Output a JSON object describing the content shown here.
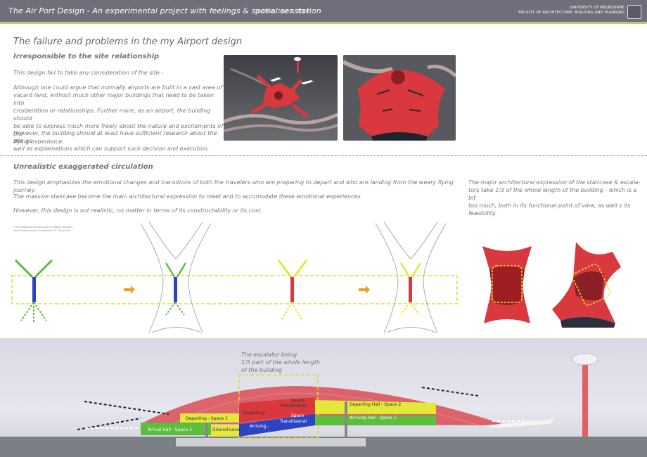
{
  "header": {
    "title": "The Air Port Design - An experimental project with feelings & spatial senstation",
    "subtitle": "3rd Year, Sem 1, 2008",
    "university": "UNIVERSITY OF MELBOURNE",
    "faculty": "FACULTY OF ARCHITECTURE, BUILDING AND PLANNING"
  },
  "section1": {
    "title": "The failure and problems in the my Airport design",
    "subtitle": "Irresponsible to the site relationship",
    "p1": "This design fail to take any consideration of the site -",
    "p2_lines": [
      "Although one could argue that normally airports are built in a vast area of",
      "vacant land, without much other major buildings that need to be taken into",
      "cnsideration or relationships. Further more, as an airport, the building should",
      "be able to express much more freely about the nature and excitements of the",
      "flying experience."
    ],
    "p3_lines": [
      "However, the building should at least have sufficient research about the site as",
      "well as explainations which can support such decision and execution."
    ]
  },
  "section2": {
    "subtitle": "Unrealistic exaggerated circulation",
    "p1": "This design emphasizes the emotional changes and transitions of both the travelers who are preparing to depart and who are landing from the weary flying journey.",
    "p2": "The massive staircase become the main architectural expression to meet and to accomodate these emotional experiences.",
    "p3": "However, this design is not realistic, no matter in terms of its constructability or its cost.",
    "side_note_lines": [
      "The major architectural expression of the staircase & escala-",
      "tors take 1/3 of the whole length of the building - which is a bit",
      "too much, both in its functional point of view, as well s its",
      "feasibility."
    ],
    "diagram_note_lines": [
      "~The diagrams showing flow of depart normally",
      "work flow/normally for departure & The arrival"
    ]
  },
  "section3": {
    "escalator_lines": [
      "The escalator being",
      "1/3 part of the whole length",
      "of the building"
    ],
    "labels": {
      "departing_space1": "Departing - Space 1",
      "departing_hall2": "Departing Hall - Space 2",
      "arrival_hall2": "Arrival Hall - Space 2",
      "ground_level": "Ground Level",
      "arriving": "Arriving -",
      "arriving_hall1": "Arriving Hall - Space 1",
      "departing": "Departing",
      "space_upper": "Space",
      "transitional_upper": "Transitiaonal",
      "space_lower": "Space",
      "transitional_lower": "Transitiaonal"
    }
  },
  "colors": {
    "header_bg": "#6e6f7a",
    "header_accent": "#c9c46a",
    "roof_red": "#d8383e",
    "yellow": "#e3e83a",
    "green": "#5cbd3e",
    "blue": "#2e43c4"
  }
}
